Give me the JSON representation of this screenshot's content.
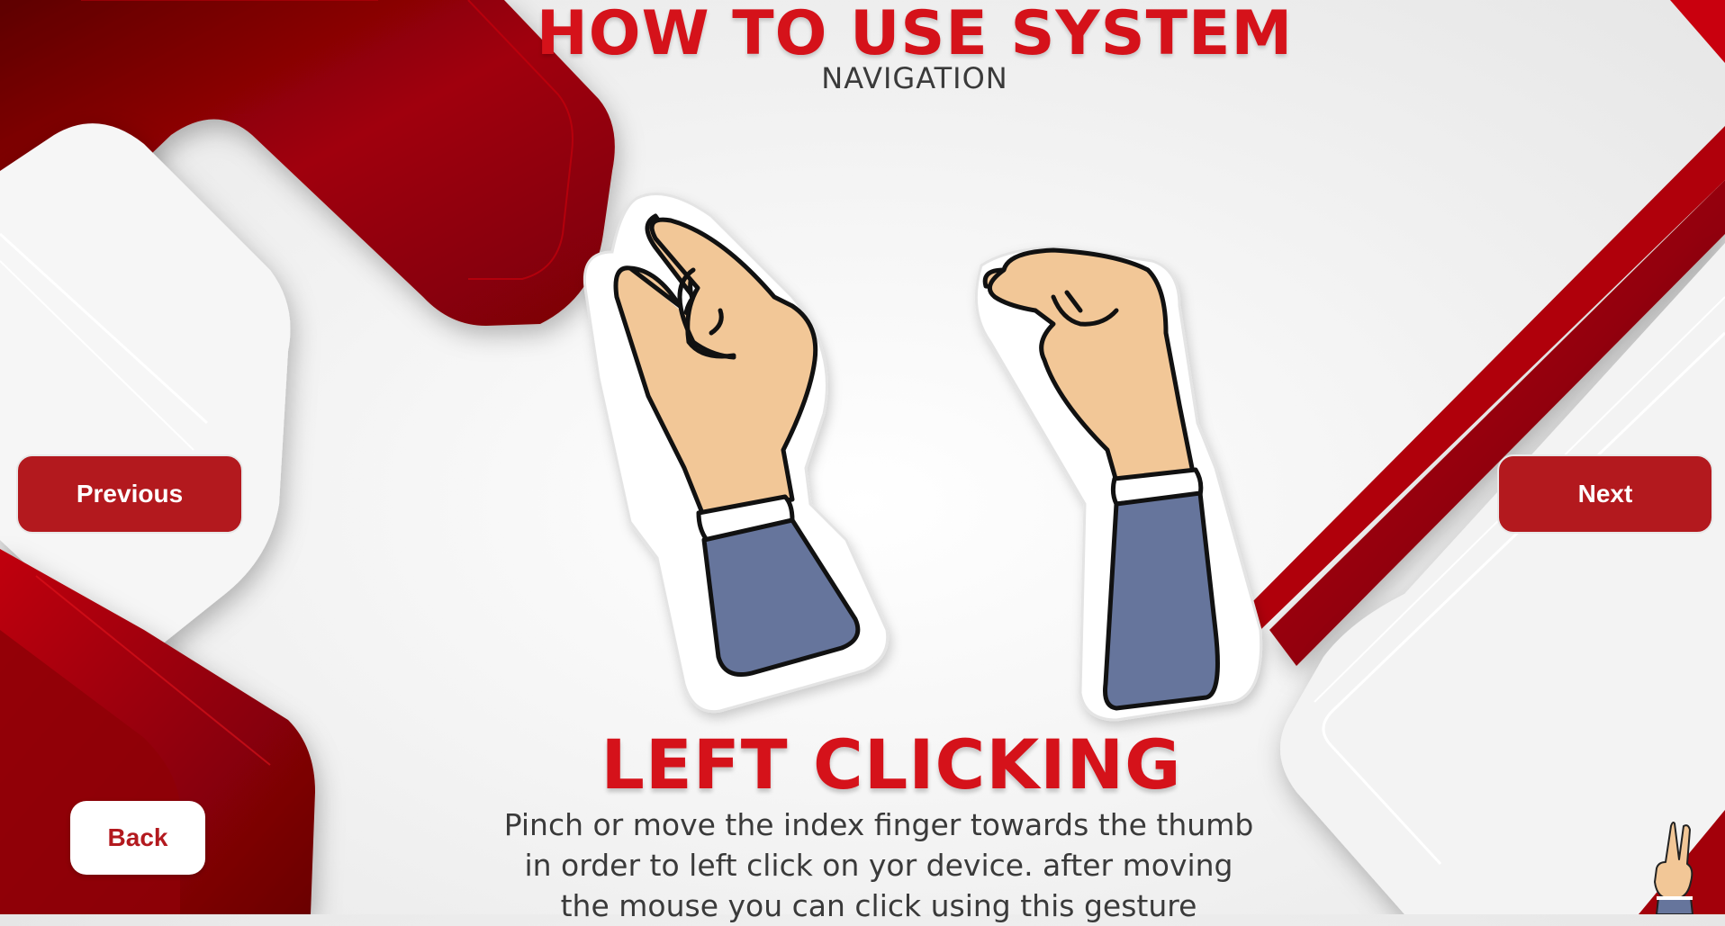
{
  "header": {
    "title": "HOW TO USE SYSTEM",
    "subtitle": "NAVIGATION"
  },
  "gesture": {
    "name": "LEFT CLICKING",
    "description_lines": [
      "Pinch or move the index finger towards the thumb",
      "in order to left click on yor device. after moving",
      "the mouse you can click using this gesture"
    ]
  },
  "buttons": {
    "previous": "Previous",
    "next": "Next",
    "back": "Back"
  },
  "colors": {
    "accent_red": "#d5121a",
    "button_red": "#b3191e",
    "skin": "#f2c797",
    "sleeve": "#66759c"
  },
  "icons": {
    "gesture_illustration": "pinch-hands-icon",
    "corner_mascot": "peace-sign-hand-icon"
  }
}
